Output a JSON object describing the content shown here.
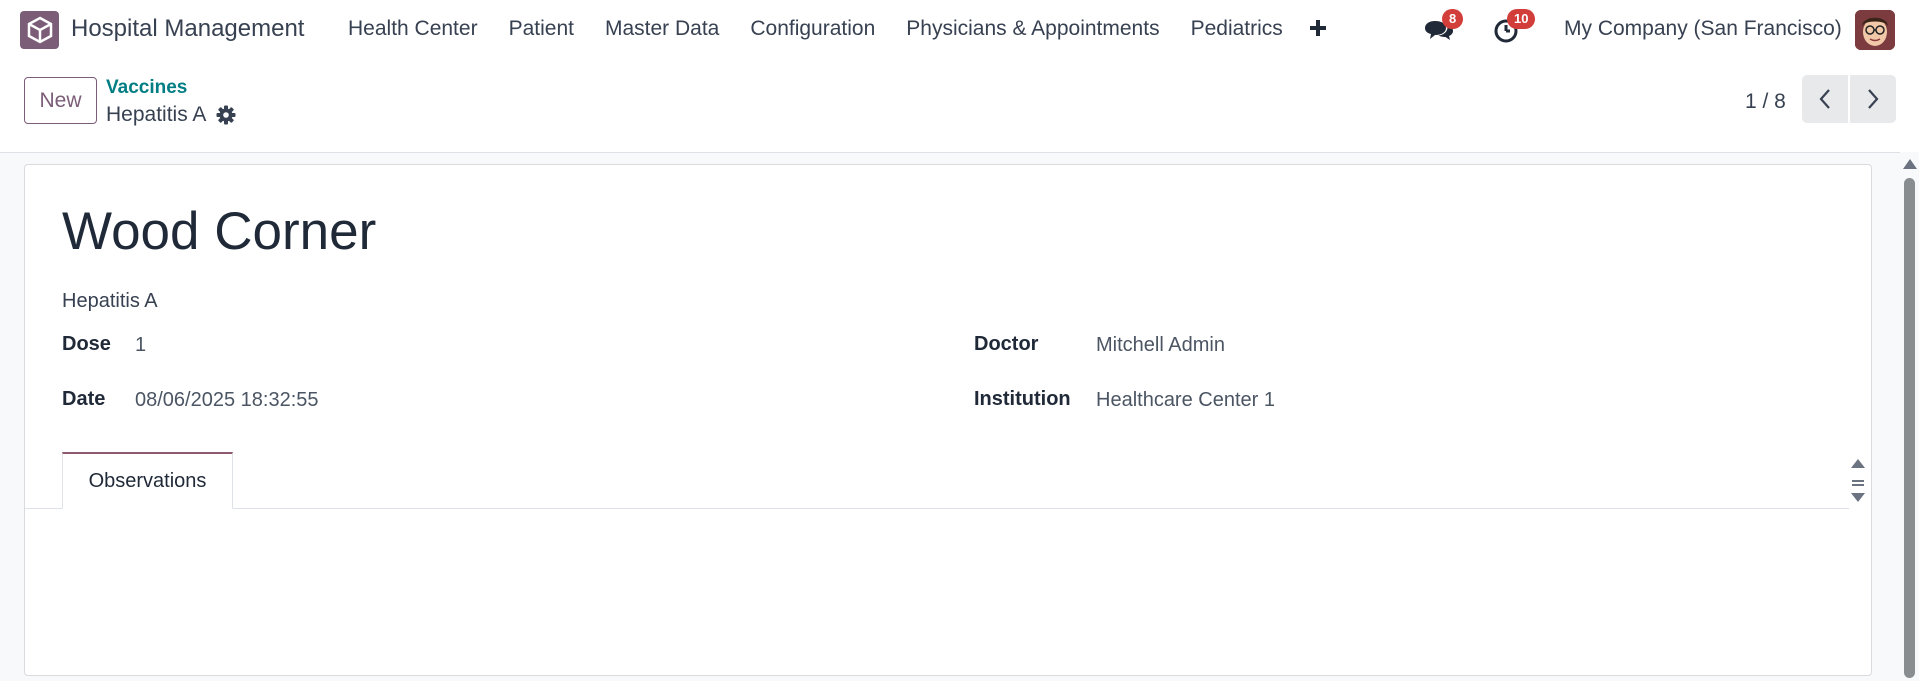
{
  "navbar": {
    "app_name": "Hospital Management",
    "menu": [
      {
        "label": "Health Center"
      },
      {
        "label": "Patient"
      },
      {
        "label": "Master Data"
      },
      {
        "label": "Configuration"
      },
      {
        "label": "Physicians & Appointments"
      },
      {
        "label": "Pediatrics"
      }
    ],
    "messages_count": "8",
    "activities_count": "10",
    "company": "My Company (San Francisco)"
  },
  "control_panel": {
    "new_label": "New",
    "breadcrumb_parent": "Vaccines",
    "breadcrumb_current": "Hepatitis A",
    "pager": "1 / 8"
  },
  "record": {
    "title": "Wood Corner",
    "vaccine": "Hepatitis A",
    "fields": {
      "dose_label": "Dose",
      "dose_value": "1",
      "date_label": "Date",
      "date_value": "08/06/2025 18:32:55",
      "doctor_label": "Doctor",
      "doctor_value": "Mitchell Admin",
      "institution_label": "Institution",
      "institution_value": "Healthcare Center 1"
    },
    "tabs": [
      {
        "label": "Observations",
        "active": true
      }
    ]
  },
  "colors": {
    "brand": "#7b5d78",
    "link": "#017e84",
    "badge": "#d23f3a"
  },
  "icons": [
    "app-logo-icon",
    "plus-icon",
    "chat-icon",
    "clock-icon",
    "gear-icon",
    "chevron-left-icon",
    "chevron-right-icon"
  ]
}
